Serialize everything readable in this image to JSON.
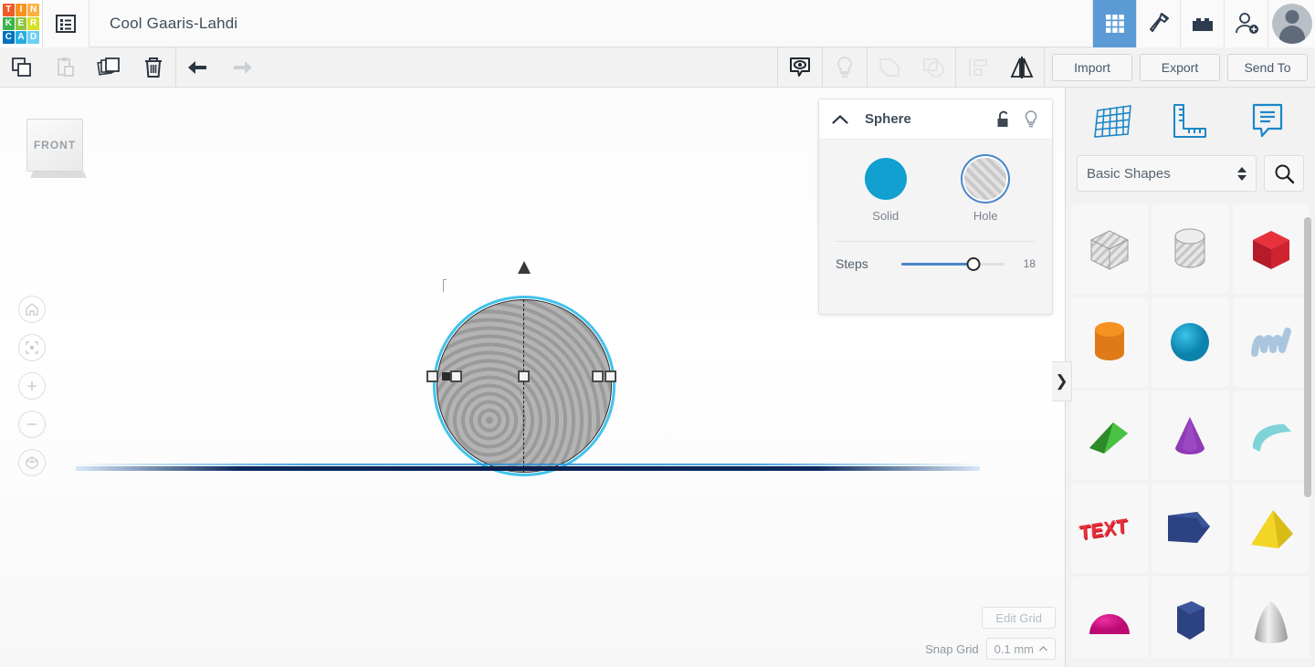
{
  "header": {
    "logo_letters": [
      {
        "ch": "T",
        "color": "#f05a28"
      },
      {
        "ch": "I",
        "color": "#f7941e"
      },
      {
        "ch": "N",
        "color": "#fbb040"
      },
      {
        "ch": "K",
        "color": "#39b54a"
      },
      {
        "ch": "E",
        "color": "#8dc63f"
      },
      {
        "ch": "R",
        "color": "#d7df23"
      },
      {
        "ch": "C",
        "color": "#0072bc"
      },
      {
        "ch": "A",
        "color": "#29abe2"
      },
      {
        "ch": "D",
        "color": "#6dcff6"
      }
    ],
    "menu_icon": "hamburger-list-icon",
    "title": "Cool Gaaris-Lahdi",
    "right_icons": [
      {
        "name": "grid-view-icon",
        "active": true
      },
      {
        "name": "hammer-tinker-icon",
        "active": false
      },
      {
        "name": "blocks-codeblocks-icon",
        "active": false
      },
      {
        "name": "add-person-icon",
        "active": false
      }
    ],
    "avatar_label": "user-avatar"
  },
  "toolbar": {
    "left_tools": [
      {
        "name": "copy-icon",
        "label": "Copy",
        "enabled": true
      },
      {
        "name": "paste-icon",
        "label": "Paste",
        "enabled": false
      },
      {
        "name": "duplicate-icon",
        "label": "Duplicate",
        "enabled": true
      },
      {
        "name": "delete-trash-icon",
        "label": "Delete",
        "enabled": true
      },
      {
        "name": "undo-icon",
        "label": "Undo",
        "enabled": true
      },
      {
        "name": "redo-icon",
        "label": "Redo",
        "enabled": false
      }
    ],
    "center_tools": [
      {
        "name": "note-eye-icon",
        "label": "Notes",
        "enabled": true
      },
      {
        "name": "lightbulb-icon",
        "label": "Hide",
        "enabled": false
      },
      {
        "name": "group-icon",
        "label": "Group",
        "enabled": false
      },
      {
        "name": "ungroup-icon",
        "label": "Ungroup",
        "enabled": false
      },
      {
        "name": "align-icon",
        "label": "Align",
        "enabled": false
      },
      {
        "name": "mirror-icon",
        "label": "Mirror",
        "enabled": true
      }
    ],
    "import_label": "Import",
    "export_label": "Export",
    "sendto_label": "Send To"
  },
  "canvas": {
    "viewcube_label": "FRONT",
    "nav_buttons": [
      {
        "name": "home-view-button",
        "label": "Home view"
      },
      {
        "name": "fit-to-view-button",
        "label": "Fit all in view"
      },
      {
        "name": "zoom-in-button",
        "label": "Zoom in"
      },
      {
        "name": "zoom-out-button",
        "label": "Zoom out"
      },
      {
        "name": "perspective-toggle-button",
        "label": "Switch to orthographic view"
      }
    ],
    "edit_grid_label": "Edit Grid",
    "snap_grid_label": "Snap Grid",
    "snap_grid_value": "0.1 mm",
    "selected_object": "sphere-hole"
  },
  "inspector": {
    "title": "Sphere",
    "collapse_icon": "chevron-up-icon",
    "lock_icon": "unlock-icon",
    "visibility_icon": "lightbulb-icon",
    "solid_label": "Solid",
    "hole_label": "Hole",
    "solid_color": "#11a0d0",
    "selected_type": "Hole",
    "steps_label": "Steps",
    "steps_value": "18",
    "steps_percent": 70
  },
  "right_panel": {
    "collapse_tab_icon": "chevron-right-icon",
    "top_icons": [
      {
        "name": "workplane-icon",
        "label": "Workplane"
      },
      {
        "name": "ruler-icon",
        "label": "Ruler"
      },
      {
        "name": "note-icon",
        "label": "Note"
      }
    ],
    "category_value": "Basic Shapes",
    "search_icon": "search-icon",
    "shapes": [
      {
        "name": "shape-box-hole",
        "label": "Box (hole)"
      },
      {
        "name": "shape-cylinder-hole",
        "label": "Cylinder (hole)"
      },
      {
        "name": "shape-box-red",
        "label": "Box"
      },
      {
        "name": "shape-cylinder-orange",
        "label": "Cylinder"
      },
      {
        "name": "shape-sphere-blue",
        "label": "Sphere"
      },
      {
        "name": "shape-scribble",
        "label": "Scribble"
      },
      {
        "name": "shape-wedge-green",
        "label": "Wedge"
      },
      {
        "name": "shape-cone-purple",
        "label": "Cone"
      },
      {
        "name": "shape-roof-teal",
        "label": "Roof"
      },
      {
        "name": "shape-text-red",
        "label": "Text"
      },
      {
        "name": "shape-arrow-navy",
        "label": "Arrow"
      },
      {
        "name": "shape-pyramid-yellow",
        "label": "Pyramid"
      },
      {
        "name": "shape-halfsphere-magenta",
        "label": "Half Sphere"
      },
      {
        "name": "shape-polygon-navy",
        "label": "Polygon"
      },
      {
        "name": "shape-paraboloid-grey",
        "label": "Paraboloid"
      }
    ]
  }
}
